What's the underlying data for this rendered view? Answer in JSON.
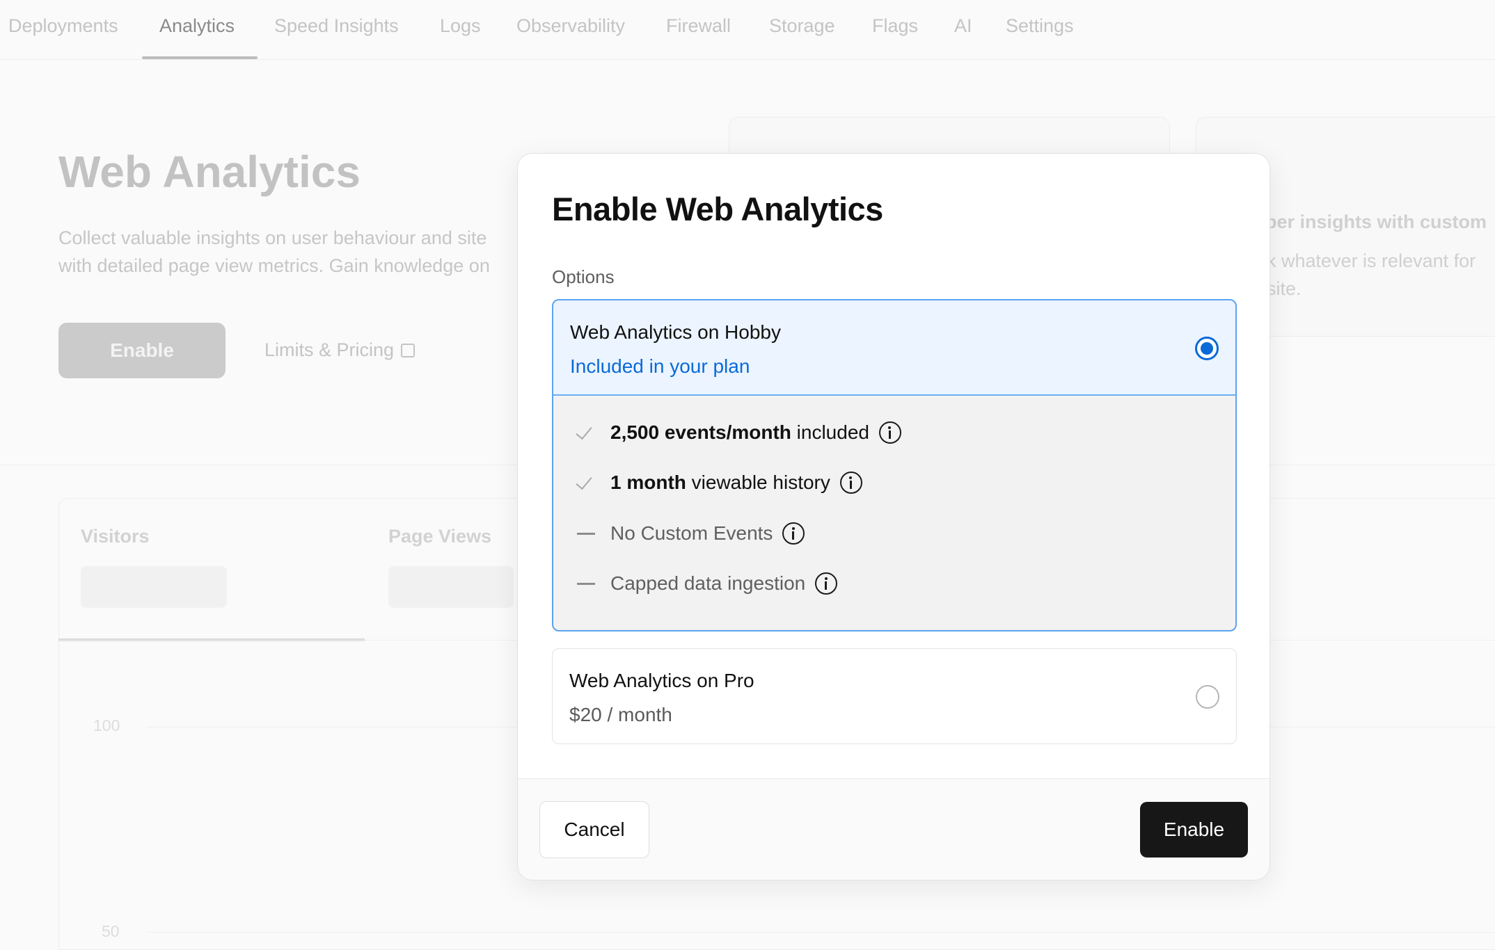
{
  "nav": {
    "tabs": [
      {
        "label": "Deployments"
      },
      {
        "label": "Analytics"
      },
      {
        "label": "Speed Insights"
      },
      {
        "label": "Logs"
      },
      {
        "label": "Observability"
      },
      {
        "label": "Firewall"
      },
      {
        "label": "Storage"
      },
      {
        "label": "Flags"
      },
      {
        "label": "AI"
      },
      {
        "label": "Settings"
      }
    ],
    "active_tab": "Analytics"
  },
  "background": {
    "title": "Web Analytics",
    "description_line1": "Collect valuable insights on user behaviour and site",
    "description_line2": "with detailed page view metrics. Gain knowledge on",
    "enable_label": "Enable",
    "limits_label": "Limits & Pricing",
    "side_card": {
      "line1": "per insights with custom",
      "line2": "k whatever is relevant for",
      "line3": "site."
    },
    "metrics": {
      "visitors_label": "Visitors",
      "page_views_label": "Page Views"
    },
    "chart_axis": {
      "tick_100": "100",
      "tick_50": "50"
    }
  },
  "modal": {
    "title": "Enable Web Analytics",
    "options_label": "Options",
    "hobby": {
      "name": "Web Analytics on Hobby",
      "subtitle": "Included in your plan",
      "selected": true,
      "features": [
        {
          "bold": "2,500 events/month",
          "rest": " included"
        },
        {
          "bold": "1 month",
          "rest": " viewable history"
        },
        {
          "bold": "",
          "rest": "No Custom Events"
        },
        {
          "bold": "",
          "rest": "Capped data ingestion"
        }
      ]
    },
    "pro": {
      "name": "Web Analytics on Pro",
      "price": "$20 / month",
      "selected": false
    },
    "cancel_label": "Cancel",
    "enable_label": "Enable"
  },
  "colors": {
    "accent_blue": "#0a6ad8",
    "selected_bg": "#ebf4ff",
    "primary_button": "#171717"
  }
}
